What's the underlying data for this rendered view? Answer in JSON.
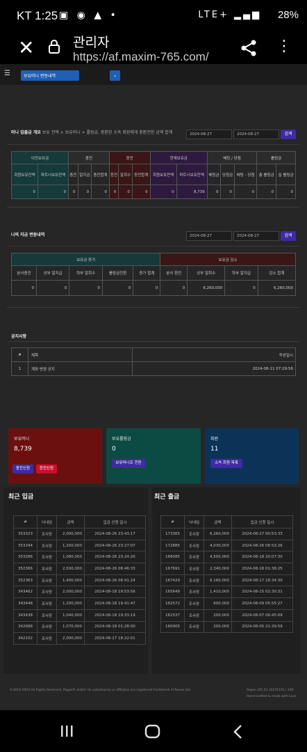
{
  "status_bar": {
    "carrier_time": "KT 1:25",
    "battery": "28%",
    "network": "LTE+"
  },
  "browser": {
    "title": "관리자",
    "url": "https://af.maxim-765.com/"
  },
  "nav": {
    "selected": "보유머니 변동내역"
  },
  "section1": {
    "title": "머니 입출금 개요",
    "breadcrumb": "보유 전액 > 보유머니 > 롤링금, 충환된 소속 회원에게 충환전한 금액 합계",
    "date_from": "2024-08-27",
    "date_to": "2024-08-27",
    "search": "검색",
    "groups": [
      "이전보유금",
      "충전",
      "환전",
      "현재보유금",
      "베팅 / 당첨",
      "롤링금"
    ],
    "subheaders": [
      "회원보유잔액",
      "파트너보유잔액",
      "충전",
      "알지금",
      "충전합계",
      "환전",
      "알회수",
      "환전합계",
      "회원보유잔액",
      "파트너보유잔액",
      "베팅금",
      "당첨금",
      "베팅 - 당첨",
      "총 롤링금",
      "실 롤링금"
    ],
    "values": [
      "0",
      "0",
      "0",
      "0",
      "0",
      "0",
      "0",
      "0",
      "0",
      "8,739",
      "0",
      "0",
      "0",
      "0",
      "0"
    ]
  },
  "section2": {
    "title": "나의 자금 변동내역",
    "date_from": "2024-08-27",
    "date_to": "2024-08-27",
    "search": "검색",
    "groups": [
      "보유금 증가",
      "보유금 감소"
    ],
    "subheaders": [
      "본사충전",
      "상부 알지급",
      "하부 알회수",
      "롤링금전환",
      "증가 합계",
      "본사 환전",
      "상부 알회수",
      "하부 알지급",
      "감소 합계"
    ],
    "values": [
      "0",
      "0",
      "0",
      "0",
      "0",
      "0",
      "6,260,000",
      "0",
      "6,260,000"
    ]
  },
  "notice": {
    "title": "공지사항",
    "headers": [
      "#",
      "제목",
      "작성일시"
    ],
    "rows": [
      {
        "no": "1",
        "subject": "계좌 변경 공지",
        "date": "2024-08-11 07:29:56"
      }
    ]
  },
  "cards": {
    "money": {
      "label": "보유머니",
      "value": "8,739",
      "btn1": "충전신청",
      "btn2": "환전신청",
      "color": "#6b0f0f"
    },
    "rolling": {
      "label": "보유롤링금",
      "value": "0",
      "btn": "보유머니로 전환",
      "color": "#0c4a44"
    },
    "members": {
      "label": "회원",
      "value": "11",
      "btn": "소속 회원 목록",
      "color": "#0b3358"
    }
  },
  "deposits": {
    "title": "최근 입금",
    "headers": [
      "#",
      "닉네임",
      "금액",
      "입금 신청 일시"
    ],
    "rows": [
      [
        "353323",
        "조사장",
        "2,000,000",
        "2024-08-26 23:43:17"
      ],
      [
        "353294",
        "조사장",
        "1,200,000",
        "2024-08-26 23:27:07"
      ],
      [
        "353286",
        "조사장",
        "1,080,000",
        "2024-08-26 23:24:20"
      ],
      [
        "352366",
        "조사장",
        "2,500,000",
        "2024-08-26 08:46:33"
      ],
      [
        "352363",
        "조사장",
        "1,400,000",
        "2024-08-26 08:41:24"
      ],
      [
        "343462",
        "조사장",
        "2,000,000",
        "2024-08-18 19:53:56"
      ],
      [
        "343448",
        "조사장",
        "1,200,000",
        "2024-08-18 19:41:47"
      ],
      [
        "343438",
        "조사장",
        "1,040,000",
        "2024-08-18 19:33:19"
      ],
      [
        "342688",
        "조사장",
        "1,070,000",
        "2024-08-18 01:28:00"
      ],
      [
        "342102",
        "조사장",
        "2,000,000",
        "2024-08-17 18:22:01"
      ]
    ]
  },
  "withdrawals": {
    "title": "최근 출금",
    "headers": [
      "#",
      "닉네임",
      "금액",
      "입금 신청 일시"
    ],
    "rows": [
      [
        "173365",
        "조사장",
        "6,260,000",
        "2024-08-27 00:53:33"
      ],
      [
        "172885",
        "조사장",
        "4,030,000",
        "2024-08-26 08:53:26"
      ],
      [
        "168085",
        "조사장",
        "4,500,000",
        "2024-08-18 20:07:30"
      ],
      [
        "167691",
        "조사장",
        "2,340,000",
        "2024-08-18 01:38:25"
      ],
      [
        "167429",
        "조사장",
        "6,160,000",
        "2024-08-17 18:34:30"
      ],
      [
        "165649",
        "조사장",
        "1,410,000",
        "2024-08-15 02:30:31"
      ],
      [
        "162572",
        "조사장",
        "600,000",
        "2024-08-09 05:55:27"
      ],
      [
        "161537",
        "조사장",
        "200,000",
        "2024-08-07 06:45:09"
      ],
      [
        "160905",
        "조사장",
        "200,000",
        "2024-08-05 21:39:59"
      ]
    ]
  },
  "footer": {
    "copyright": "©2014-2023 All Rights Reserved. Pages® and/or its subsidiaries or affiliates are registered trademark of Revox Ltd.",
    "version": "Pages v05.23 20231105.r.190",
    "crafted": "Hand-crafted & made with Love"
  }
}
